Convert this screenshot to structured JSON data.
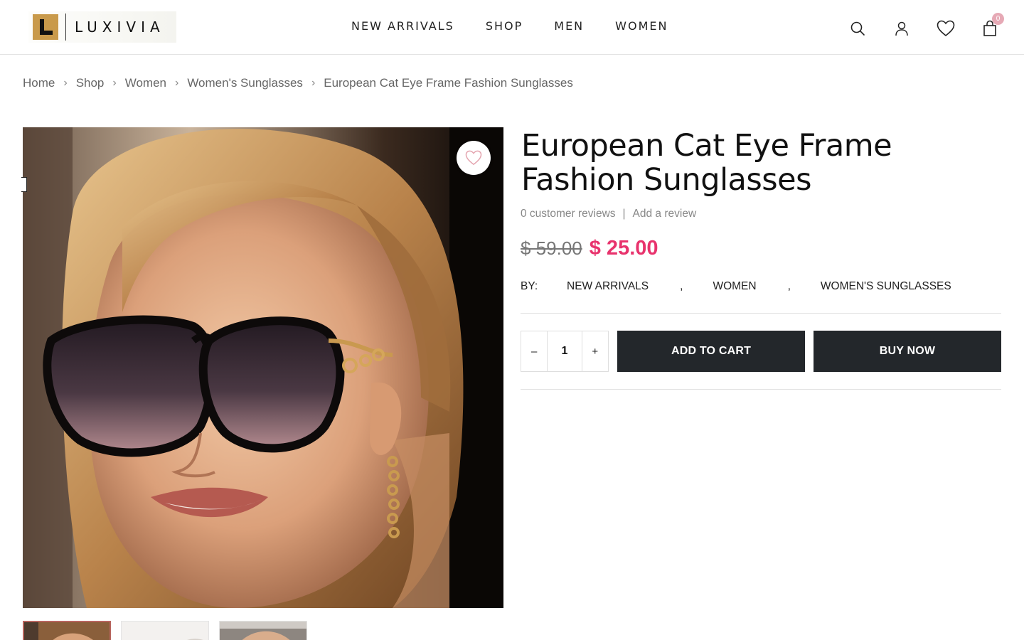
{
  "brand": {
    "name": "LUXIVIA",
    "logo_letter": "L",
    "accent": "#c99a4b"
  },
  "nav": [
    {
      "label": "NEW ARRIVALS"
    },
    {
      "label": "SHOP"
    },
    {
      "label": "MEN"
    },
    {
      "label": "WOMEN"
    }
  ],
  "header_icons": {
    "search": "search-icon",
    "account": "user-icon",
    "wishlist": "heart-icon",
    "cart": "shopping-bag-icon",
    "cart_count": "0"
  },
  "breadcrumb": [
    {
      "label": "Home"
    },
    {
      "label": "Shop"
    },
    {
      "label": "Women"
    },
    {
      "label": "Women's Sunglasses"
    },
    {
      "label": "European Cat Eye Frame Fashion Sunglasses"
    }
  ],
  "breadcrumb_separator": "›",
  "product": {
    "title": "European Cat Eye Frame Fashion Sunglasses",
    "reviews_text": "0 customer reviews",
    "reviews_separator": "|",
    "add_review_label": "Add a review",
    "old_price": "$ 59.00",
    "new_price": "$ 25.00",
    "sale_color": "#e8336d",
    "by_label": "BY:",
    "categories": [
      "NEW ARRIVALS",
      "WOMEN",
      "WOMEN'S SUNGLASSES"
    ],
    "category_separator": ",",
    "quantity": "1",
    "qty_minus": "–",
    "qty_plus": "+",
    "add_to_cart_label": "ADD TO CART",
    "buy_now_label": "BUY NOW",
    "button_color": "#23272b"
  },
  "gallery": {
    "main_image": "woman-wearing-oversized-black-cat-eye-sunglasses",
    "thumbnails": [
      "thumbnail-1",
      "thumbnail-2",
      "thumbnail-3"
    ]
  }
}
